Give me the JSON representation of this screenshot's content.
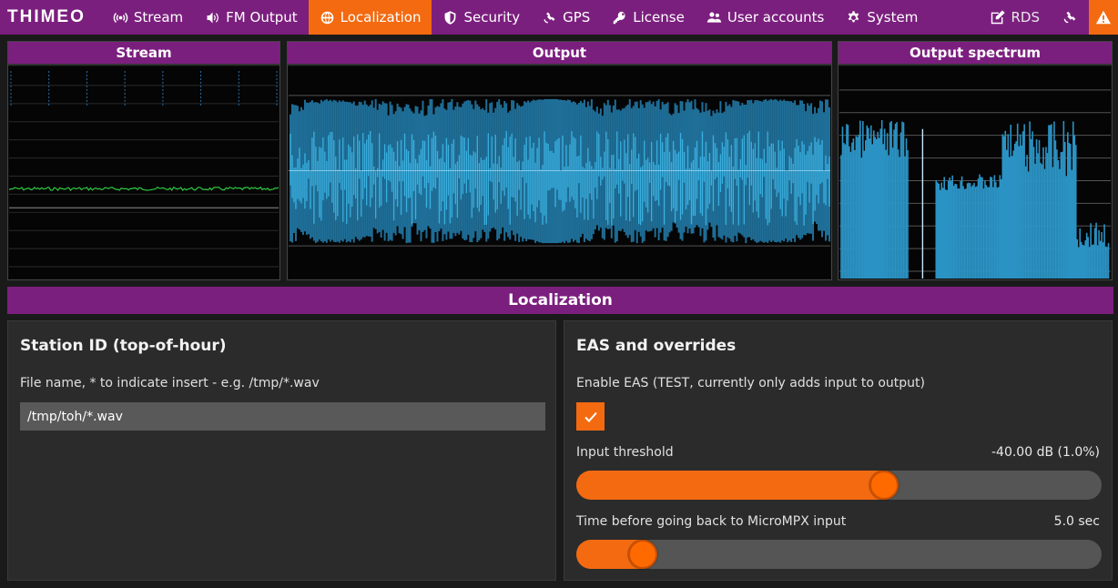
{
  "app": {
    "logo": "THIMEO"
  },
  "nav": {
    "items": [
      {
        "label": "Stream",
        "icon": "broadcast-icon"
      },
      {
        "label": "FM Output",
        "icon": "speaker-icon"
      },
      {
        "label": "Localization",
        "icon": "globe-icon",
        "active": true
      },
      {
        "label": "Security",
        "icon": "shield-icon"
      },
      {
        "label": "GPS",
        "icon": "satellite-icon"
      },
      {
        "label": "License",
        "icon": "key-icon"
      },
      {
        "label": "User accounts",
        "icon": "users-icon"
      },
      {
        "label": "System",
        "icon": "gear-icon"
      }
    ],
    "rds_label": "RDS"
  },
  "scopes": {
    "stream_title": "Stream",
    "output_title": "Output",
    "spectrum_title": "Output spectrum"
  },
  "section_title": "Localization",
  "station_id": {
    "title": "Station ID (top-of-hour)",
    "file_label": "File name, * to indicate insert - e.g. /tmp/*.wav",
    "file_value": "/tmp/toh/*.wav"
  },
  "eas": {
    "title": "EAS and overrides",
    "enable_label": "Enable EAS (TEST, currently only adds input to output)",
    "enabled": true,
    "threshold_label": "Input threshold",
    "threshold_value": "-40.00 dB (1.0%)",
    "threshold_fraction": 0.59,
    "time_label": "Time before going back to MicroMPX input",
    "time_value": "5.0 sec",
    "time_fraction": 0.105
  },
  "colors": {
    "brand_purple": "#7b1f7e",
    "accent_orange": "#f36a10",
    "waveform_blue": "#3ab0e0",
    "trace_green": "#2ecc40"
  }
}
